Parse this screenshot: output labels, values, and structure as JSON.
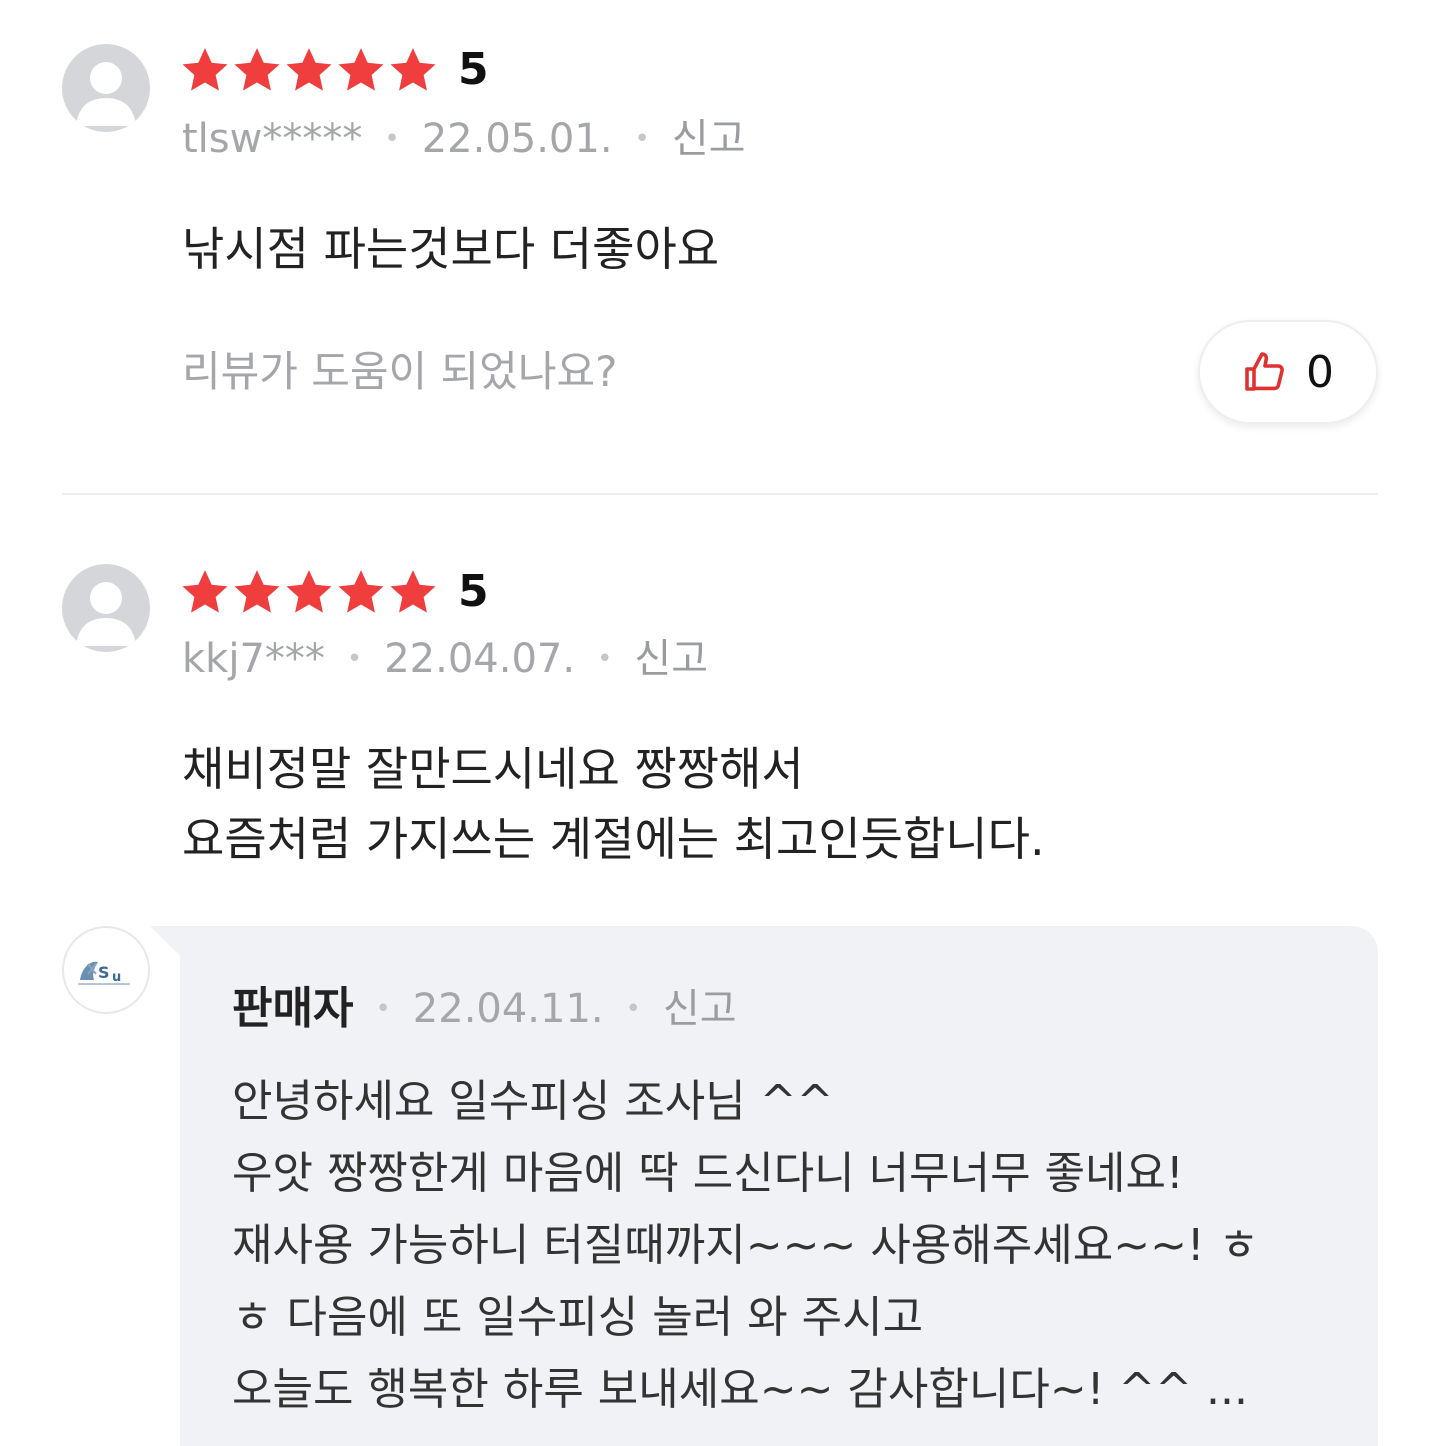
{
  "colors": {
    "star": "#f03e3e",
    "accent": "#e03131",
    "muted": "#a4a6aa",
    "reply_bg": "#f1f2f5"
  },
  "reviews": [
    {
      "rating": 5,
      "rating_label": "5",
      "user": "tlsw*****",
      "date": "22.05.01.",
      "report": "신고",
      "text_lines": [
        "낚시점 파는것보다 더좋아요"
      ],
      "helpful_prompt": "리뷰가 도움이 되었나요?",
      "like_count": "0"
    },
    {
      "rating": 5,
      "rating_label": "5",
      "user": "kkj7***",
      "date": "22.04.07.",
      "report": "신고",
      "text_lines": [
        "채비정말 잘만드시네요 짱짱해서",
        "요즘처럼 가지쓰는 계절에는 최고인듯합니다."
      ],
      "reply": {
        "author": "판매자",
        "date": "22.04.11.",
        "report": "신고",
        "lines": [
          "안녕하세요 일수피싱 조사님 ^^",
          "우앗 짱짱한게 마음에 딱 드신다니 너무너무 좋네요!",
          "재사용 가능하니 터질때까지~~~ 사용해주세요~~! ㅎ",
          "ㅎ 다음에 또 일수피싱 놀러 와 주시고",
          "오늘도 행복한 하루 보내세요~~ 감사합니다~! ^^ ..."
        ]
      }
    }
  ]
}
